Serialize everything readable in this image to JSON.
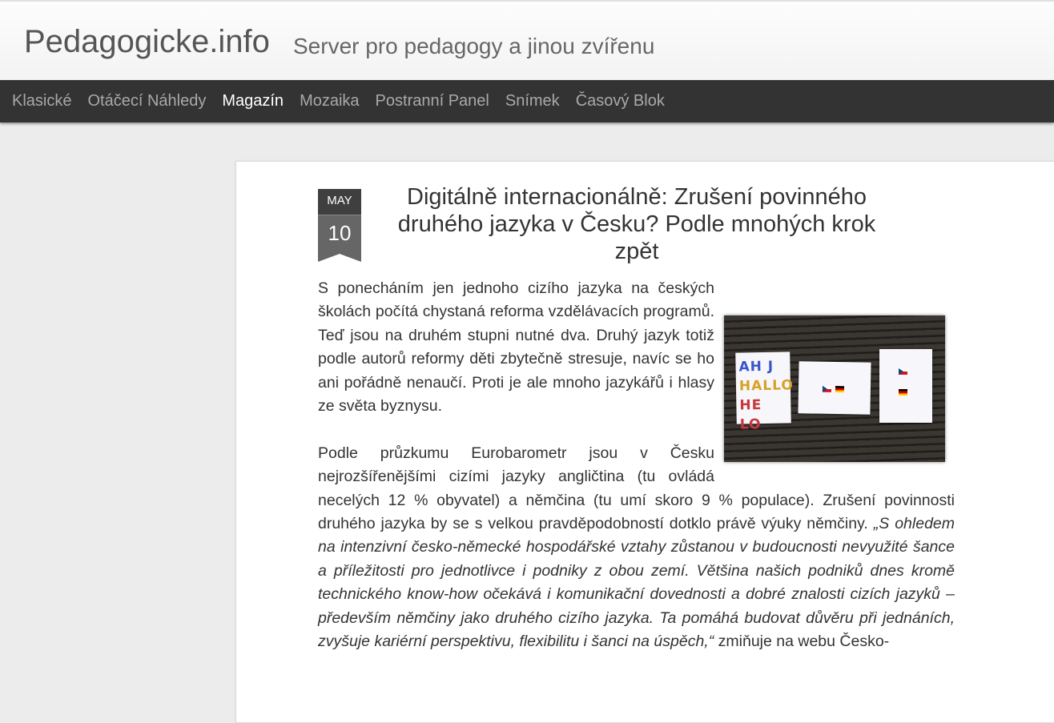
{
  "site": {
    "title": "Pedagogicke.info",
    "tagline": "Server pro pedagogy a jinou zvířenu"
  },
  "nav": {
    "items": [
      {
        "label": "Klasické",
        "active": false
      },
      {
        "label": "Otáčecí Náhledy",
        "active": false
      },
      {
        "label": "Magazín",
        "active": true
      },
      {
        "label": "Mozaika",
        "active": false
      },
      {
        "label": "Postranní Panel",
        "active": false
      },
      {
        "label": "Snímek",
        "active": false
      },
      {
        "label": "Časový Blok",
        "active": false
      }
    ]
  },
  "post": {
    "date": {
      "month": "MAY",
      "day": "10"
    },
    "title": "Digitálně internacionálně: Zrušení povinného druhého jazyka v Česku? Podle mnohých krok zpět",
    "paragraph1": "S ponecháním jen jednoho cizího jazyka na českých školách počítá chystaná reforma vzdělávacích programů. Teď jsou na druhém stupni nutné dva. Druhý jazyk totiž podle autorů reformy děti zbytečně stresuje, navíc se ho ani pořádně nenaučí. Proti je ale mnoho jazykářů i hlasy ze světa byznysu.",
    "paragraph2_lead": "Podle průzkumu Eurobarometr jsou v Česku nejrozšířenějšími cizími jazyky angličtina (tu ovládá necelých 12 % obyvatel) a němčina (tu umí skoro 9 % populace). Zrušení povinnosti druhého jazyka by se s velkou pravděpodobností dotklo právě výuky němčiny. ",
    "paragraph2_quote": "„S ohledem na intenzivní česko-německé hospodářské vztahy zůstanou v budoucnosti nevyužité šance a příležitosti pro jednotlivce i podniky z obou zemí. Většina našich podniků dnes kromě technického know-how očekává i komunikační dovednosti a dobré znalosti cizích jazyků – především němčiny jako druhého cizího jazyka. Ta pomáhá budovat důvěru při jednáních, zvyšuje kariérní perspektivu, flexibilitu i šanci na úspěch,“",
    "paragraph2_tail": " zmiňuje na webu Česko-",
    "image": {
      "sign_lines": [
        "AH J",
        "HALLO",
        "HE LO"
      ]
    }
  }
}
